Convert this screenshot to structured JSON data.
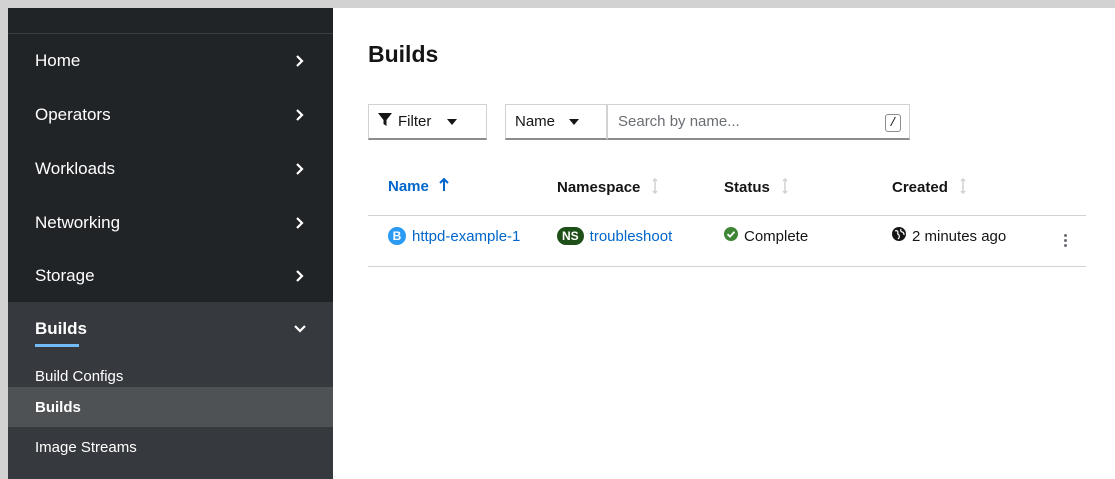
{
  "sidebar": {
    "items": [
      {
        "label": "Home"
      },
      {
        "label": "Operators"
      },
      {
        "label": "Workloads"
      },
      {
        "label": "Networking"
      },
      {
        "label": "Storage"
      },
      {
        "label": "Builds"
      }
    ],
    "subitems": [
      {
        "label": "Build Configs"
      },
      {
        "label": "Builds"
      },
      {
        "label": "Image Streams"
      }
    ]
  },
  "main": {
    "title": "Builds",
    "toolbar": {
      "filter_label": "Filter",
      "name_select_value": "Name",
      "search_placeholder": "Search by name...",
      "search_hint": "/"
    },
    "table": {
      "columns": [
        "Name",
        "Namespace",
        "Status",
        "Created"
      ],
      "rows": [
        {
          "name_badge": "B",
          "name": "httpd-example-1",
          "namespace_badge": "NS",
          "namespace": "troubleshoot",
          "status": "Complete",
          "created": "2 minutes ago"
        }
      ]
    }
  },
  "colors": {
    "sidebar_bg": "#212427",
    "sidebar_active": "#36393d",
    "link": "#0066cc",
    "status_success": "#3e8635",
    "ns_badge": "#1e4f18",
    "b_badge": "#2b9af3"
  },
  "icons": [
    "chevron-right-icon",
    "chevron-down-icon",
    "filter-icon",
    "caret-down-icon",
    "sort-arrow-up-icon",
    "sort-icon",
    "check-circle-icon",
    "globe-icon",
    "kebab-icon"
  ]
}
